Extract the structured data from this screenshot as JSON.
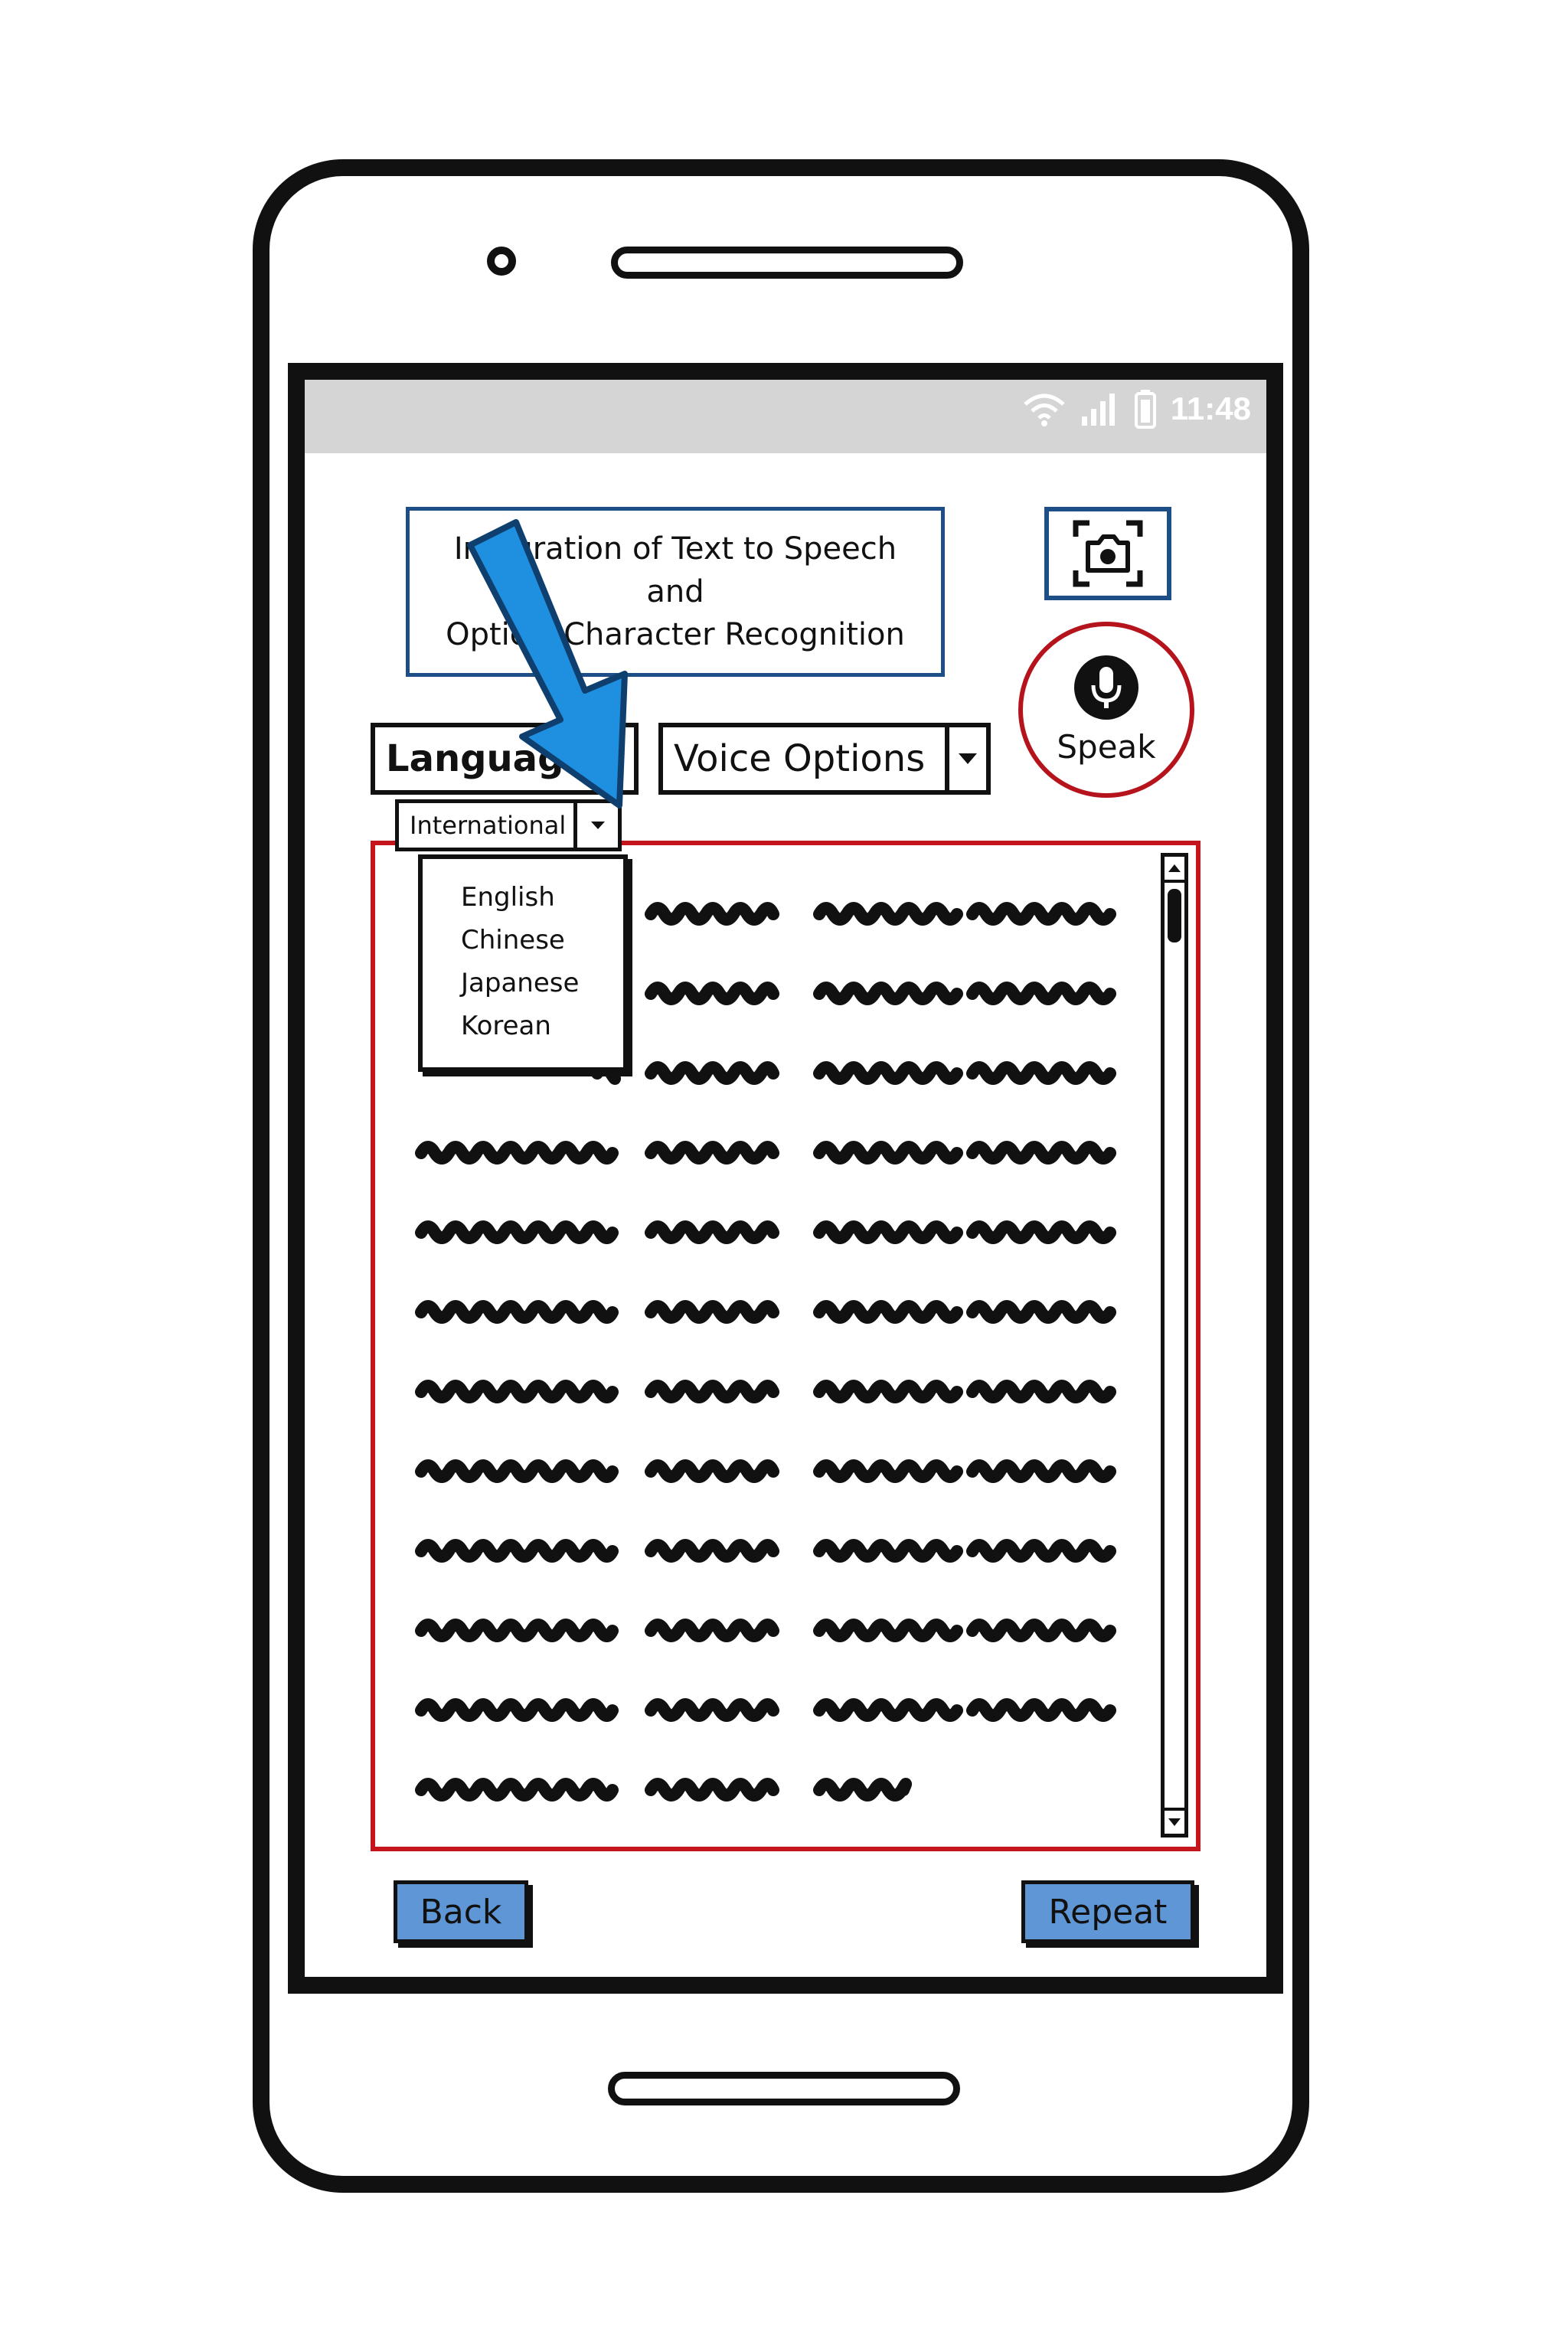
{
  "statusbar": {
    "time": "11:48",
    "icons": [
      "wifi-icon",
      "signal-icon",
      "battery-icon"
    ]
  },
  "header": {
    "title_lines": [
      "Integration of Text to Speech",
      "and",
      "Optical Character Recognition"
    ]
  },
  "buttons": {
    "camera_icon": "camera-scan-icon",
    "speak_label": "Speak",
    "speak_icon": "microphone-icon",
    "back_label": "Back",
    "repeat_label": "Repeat"
  },
  "dropdowns": {
    "language_label": "Language",
    "voice_label": "Voice Options",
    "sub_label": "International",
    "language_options": [
      "English",
      "Chinese",
      "Japanese",
      "Korean"
    ]
  },
  "colors": {
    "accent_blue": "#5f96d6",
    "border_blue": "#1e4e86",
    "speak_red": "#b5141c",
    "textarea_red": "#c4141c",
    "annotation_arrow": "#1f8fe0",
    "statusbar_gray": "#d5d5d5"
  }
}
